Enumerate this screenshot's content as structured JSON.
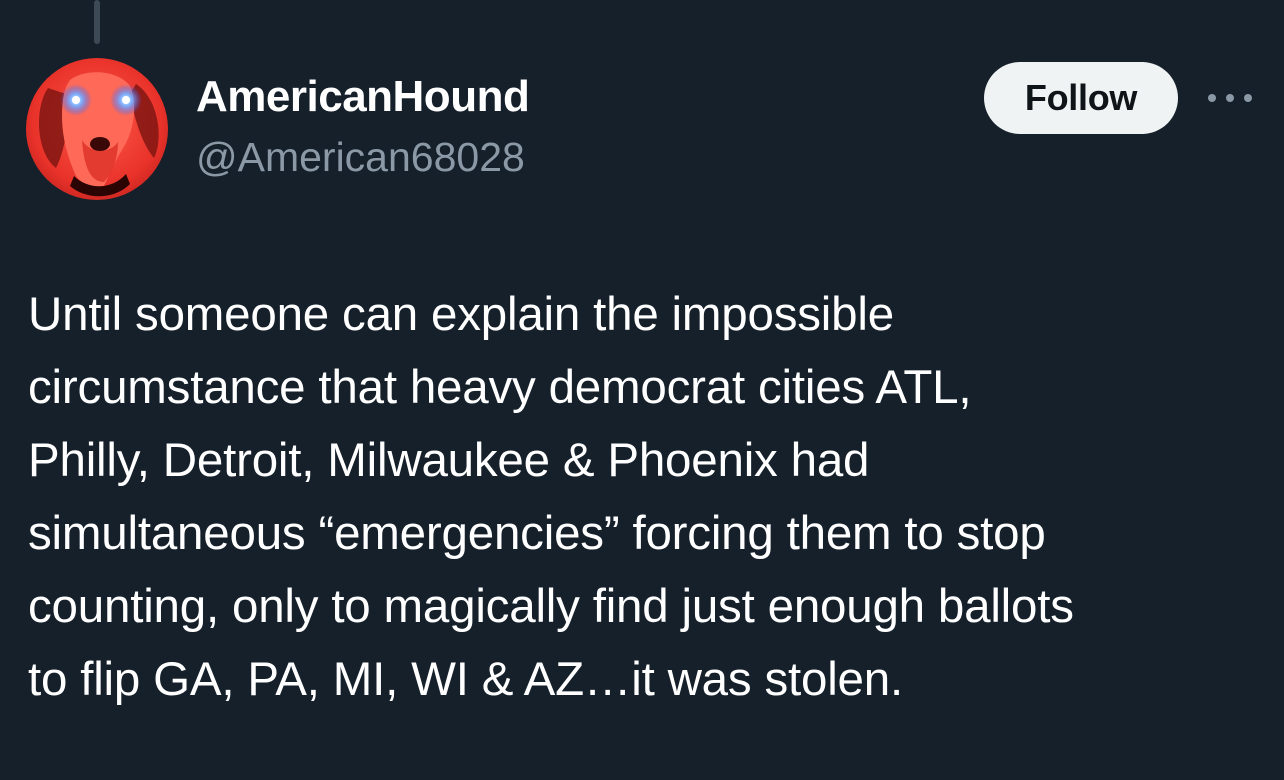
{
  "author": {
    "display_name": "AmericanHound",
    "handle": "@American68028",
    "avatar_description": "red-tinted hound dog with glowing blue eyes"
  },
  "actions": {
    "follow_label": "Follow",
    "more_icon": "more-horizontal-icon"
  },
  "tweet": {
    "text_lines": [
      "Until someone can explain the impossible",
      "circumstance that heavy democrat cities ATL,",
      "Philly, Detroit, Milwaukee & Phoenix had",
      "simultaneous “emergencies” forcing them to stop",
      "counting, only to magically find just enough ballots",
      "to flip GA, PA, MI, WI & AZ…it was stolen."
    ]
  },
  "colors": {
    "background": "#15202b",
    "secondary_text": "#8b98a5",
    "follow_button_bg": "#eff3f4"
  }
}
